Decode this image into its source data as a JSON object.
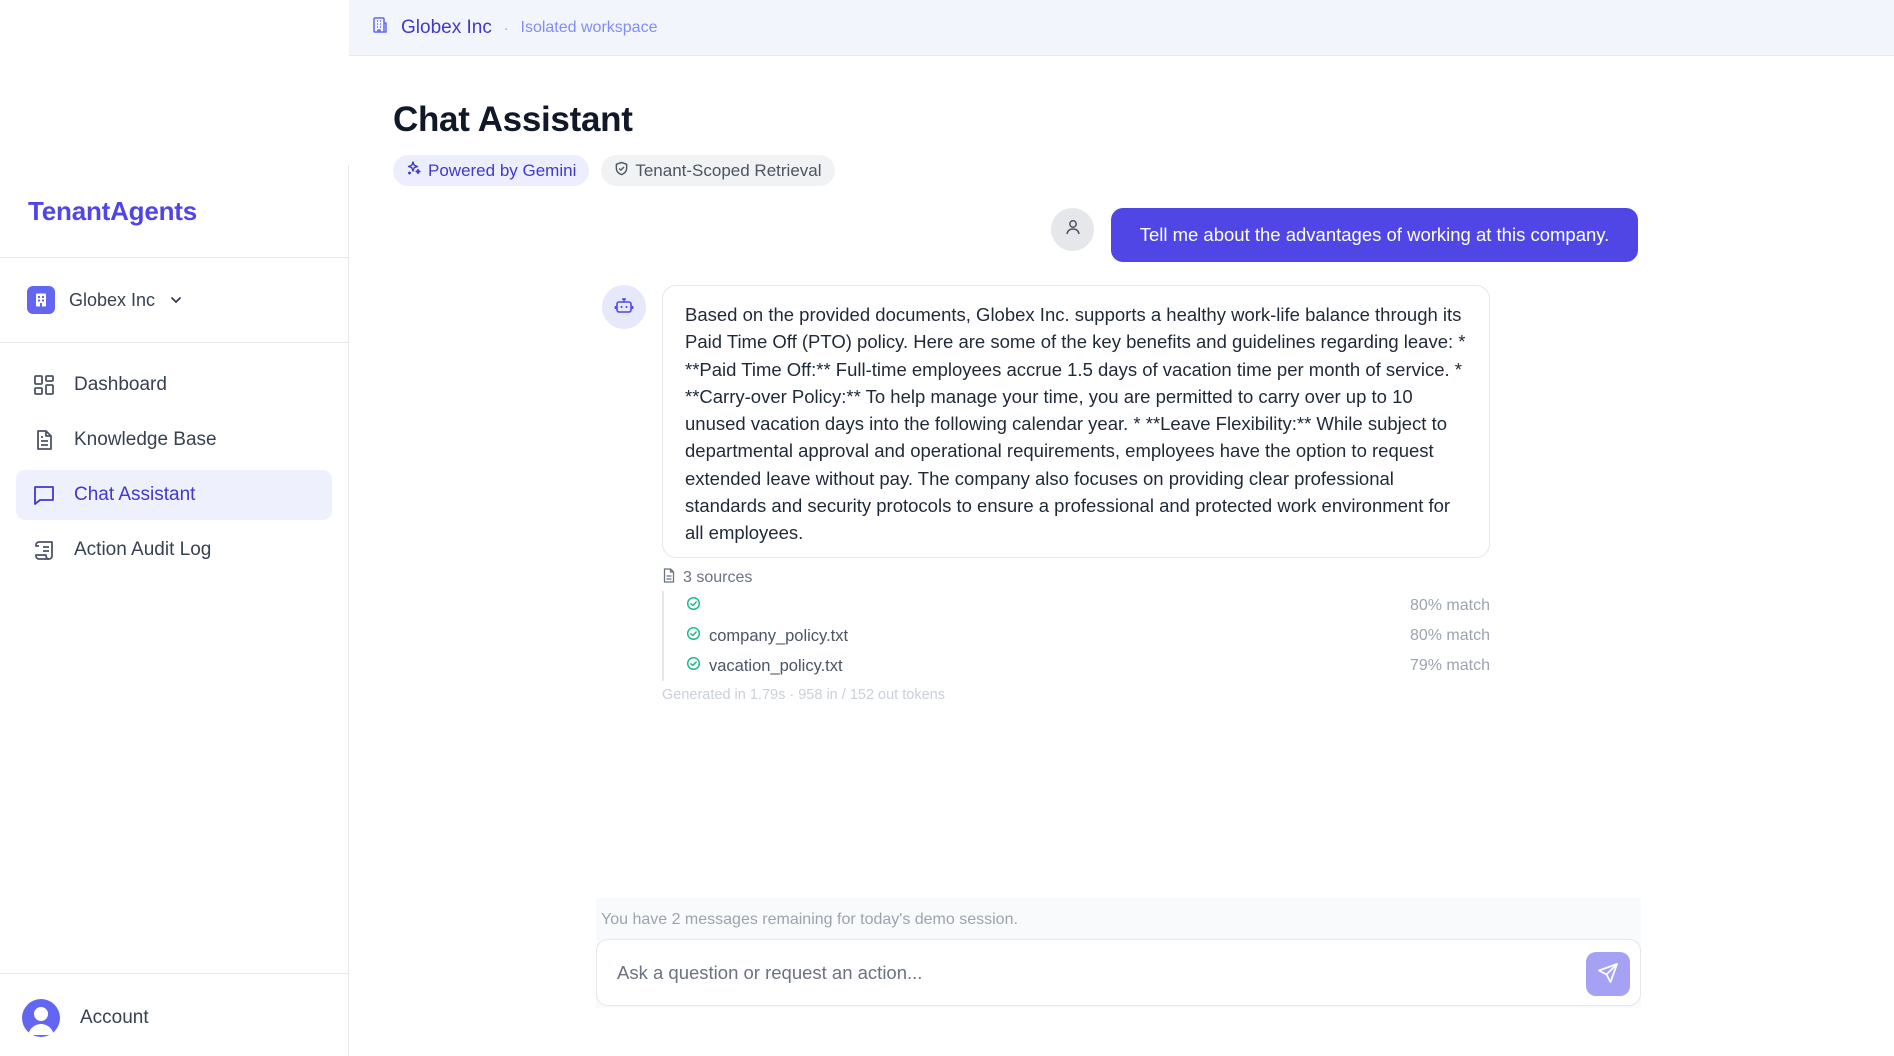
{
  "sidebar": {
    "brand": "TenantAgents",
    "tenant_name": "Globex Inc",
    "items": [
      {
        "label": "Dashboard",
        "icon": "dashboard-grid-icon"
      },
      {
        "label": "Knowledge Base",
        "icon": "document-icon"
      },
      {
        "label": "Chat Assistant",
        "icon": "chat-bubble-icon",
        "active": true
      },
      {
        "label": "Action Audit Log",
        "icon": "scroll-log-icon"
      }
    ],
    "account_label": "Account"
  },
  "topbar": {
    "tenant": "Globex Inc",
    "separator": "·",
    "subtitle": "Isolated workspace"
  },
  "main": {
    "title": "Chat Assistant",
    "badges": [
      {
        "label": "Powered by Gemini",
        "icon": "sparkles-icon"
      },
      {
        "label": "Tenant-Scoped Retrieval",
        "icon": "shield-icon"
      }
    ]
  },
  "messages": {
    "user": "Tell me about the advantages of working at this company.",
    "assistant": "Based on the provided documents, Globex Inc. supports a healthy work-life balance through its Paid Time Off (PTO) policy. Here are some of the key benefits and guidelines regarding leave: * **Paid Time Off:** Full-time employees accrue 1.5 days of vacation time per month of service. * **Carry-over Policy:** To help manage your time, you are permitted to carry over up to 10 unused vacation days into the following calendar year. * **Leave Flexibility:** While subject to departmental approval and operational requirements, employees have the option to request extended leave without pay. The company also focuses on providing clear professional standards and security protocols to ensure a professional and protected work environment for all employees.",
    "sources_label": "3 sources",
    "sources": [
      {
        "name": "",
        "match": "80% match"
      },
      {
        "name": "company_policy.txt",
        "match": "80% match"
      },
      {
        "name": "vacation_policy.txt",
        "match": "79% match"
      }
    ],
    "generation_info": "Generated in 1.79s · 958 in / 152 out tokens"
  },
  "composer": {
    "remaining": "You have 2 messages remaining for today's demo session.",
    "placeholder": "Ask a question or request an action...",
    "value": ""
  },
  "colors": {
    "accent": "#4f46e5",
    "accent_light": "#eef0fd",
    "send_disabled": "#a5a1f4",
    "success": "#10b981"
  }
}
